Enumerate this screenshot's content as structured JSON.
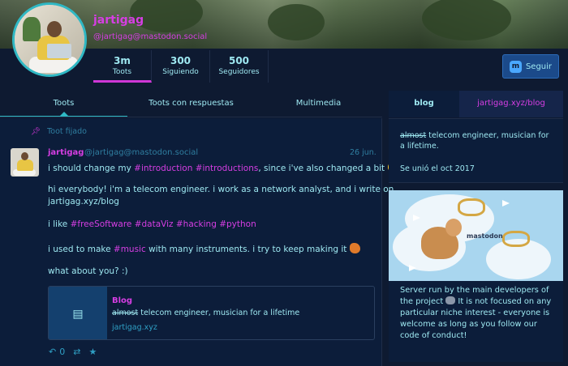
{
  "profile": {
    "display_name": "jartigag",
    "handle": "@jartigag@mastodon.social",
    "stats": [
      {
        "value": "3m",
        "label": "Toots"
      },
      {
        "value": "300",
        "label": "Siguiendo"
      },
      {
        "value": "500",
        "label": "Seguidores"
      }
    ],
    "follow_label": "Seguir",
    "follow_icon": "mastodon-logo-icon"
  },
  "tabs": [
    "Toots",
    "Toots con respuestas",
    "Multimedia"
  ],
  "pinned": {
    "icon": "pin-icon",
    "label": "Toot fijado"
  },
  "toot": {
    "author": "jartigag",
    "handle": "@jartigag@mastodon.social",
    "date": "26 jun.",
    "line1_pre": "i should change my ",
    "line1_tag1": "#introduction",
    "line1_mid": " ",
    "line1_tag2": "#introductions",
    "line1_post": ", since i've also changed a bit",
    "line2": "hi everybody! i'm a telecom engineer. i work as a network analyst, and i write on",
    "line3": "jartigag.xyz/blog",
    "line4_pre": "i like ",
    "line4_tags": "#freeSoftware #dataViz #hacking #python",
    "line5_pre": "i used to make ",
    "line5_tag": "#music",
    "line5_post": " with many instruments. i try to keep making it",
    "line6": "what about you? :)",
    "card": {
      "title": "Blog",
      "desc_strike": "almost",
      "desc_rest": " telecom engineer, musician for a lifetime",
      "host": "jartigag.xyz"
    },
    "reply_count": "0"
  },
  "sidebar": {
    "tabs": [
      "blog",
      "jartigag.xyz/blog"
    ],
    "bio_strike": "almost",
    "bio_rest": " telecom engineer, musician for a lifetime.",
    "joined": "Se unió el oct 2017",
    "promo_label": "mastodon",
    "about_pre": "Server run by the main developers of the project ",
    "about_post": " It is not focused on any particular niche interest - everyone is welcome as long as you follow our code of conduct!"
  },
  "colors": {
    "background": "#0e1a31",
    "accent": "#d63ee3",
    "text": "#9ee8f1",
    "button": "#1b4a8a"
  }
}
